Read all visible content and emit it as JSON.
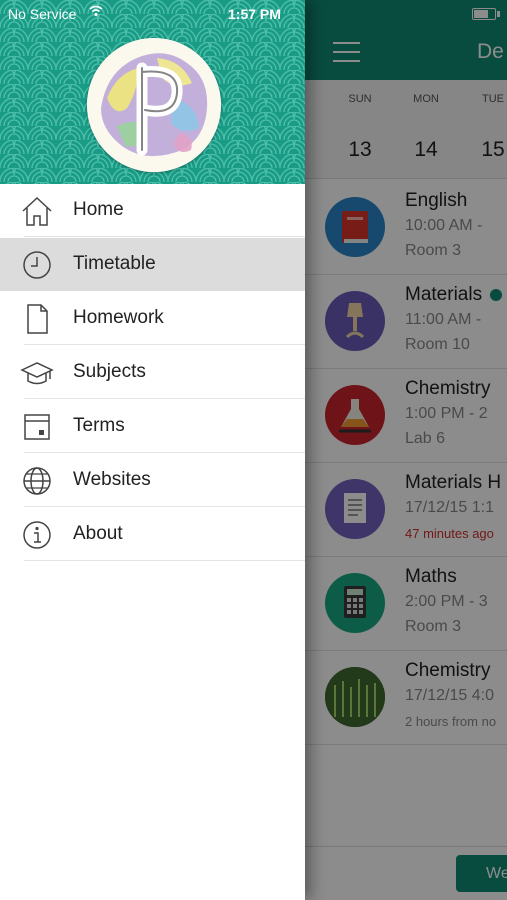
{
  "status_bar": {
    "carrier": "No Service",
    "time": "1:57 PM"
  },
  "menu": {
    "items": [
      {
        "label": "Home",
        "icon": "home-icon"
      },
      {
        "label": "Timetable",
        "icon": "clock-icon",
        "active": true
      },
      {
        "label": "Homework",
        "icon": "document-icon"
      },
      {
        "label": "Subjects",
        "icon": "graduation-cap-icon"
      },
      {
        "label": "Terms",
        "icon": "calendar-icon"
      },
      {
        "label": "Websites",
        "icon": "globe-icon"
      },
      {
        "label": "About",
        "icon": "info-icon"
      }
    ]
  },
  "content": {
    "title": "De",
    "days": [
      {
        "name": "SUN",
        "date": "13"
      },
      {
        "name": "MON",
        "date": "14"
      },
      {
        "name": "TUE",
        "date": "15"
      }
    ],
    "lessons": [
      {
        "title": "English",
        "line2": "10:00 AM -",
        "line3": "Room 3",
        "icon": "book-icon"
      },
      {
        "title": "Materials",
        "line2": "11:00 AM -",
        "line3": "Room 10",
        "icon": "lamp-icon",
        "indicator": true
      },
      {
        "title": "Chemistry",
        "line2": "1:00 PM - 2",
        "line3": "Lab 6",
        "icon": "flask-icon"
      },
      {
        "title": "Materials H",
        "line2": "17/12/15 1:1",
        "line3": "47 minutes ago",
        "icon": "document-icon",
        "line3_style": "red"
      },
      {
        "title": "Maths",
        "line2": "2:00 PM - 3",
        "line3": "Room 3",
        "icon": "calculator-icon"
      },
      {
        "title": "Chemistry",
        "line2": "17/12/15 4:0",
        "line3": "2 hours from no",
        "icon": "plants-photo",
        "line3_style": "small"
      }
    ],
    "bottom_button": "We"
  },
  "colors": {
    "brand_green": "#0f8a73",
    "header_teal": "#199b86",
    "overdue_red": "#d0302e"
  }
}
